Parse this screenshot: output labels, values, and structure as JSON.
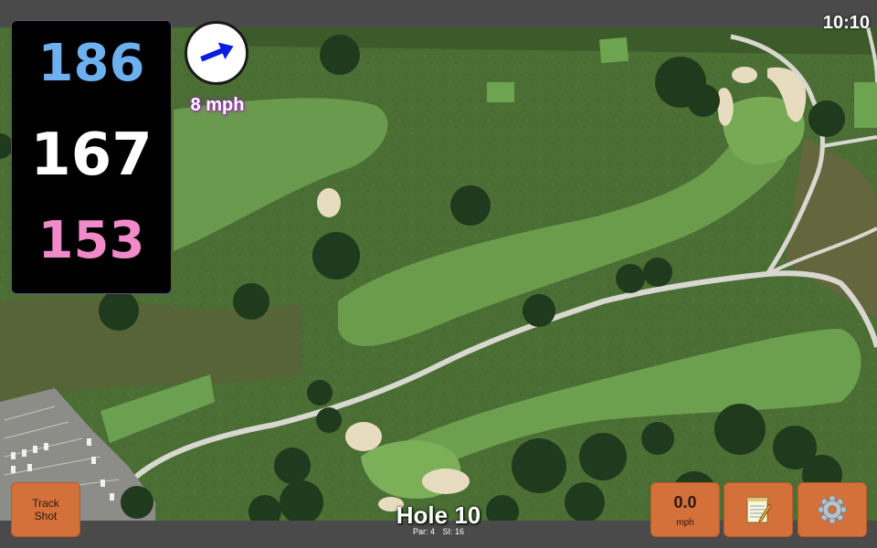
{
  "status": {
    "time": "10:10"
  },
  "distances": {
    "back": "186",
    "middle": "167",
    "front": "153"
  },
  "wind": {
    "speed": "8 mph",
    "direction_icon": "wind-arrow-icon"
  },
  "hole": {
    "title": "Hole 10",
    "par": "Par: 4",
    "stroke_index": "SI: 16"
  },
  "buttons": {
    "track_shot_line1": "Track",
    "track_shot_line2": "Shot",
    "wind_value": "0.0",
    "wind_unit": "mph",
    "notes_icon": "notepad-icon",
    "settings_icon": "gear-icon"
  },
  "colors": {
    "back_distance": "#6cb0f0",
    "middle_distance": "#ffffff",
    "front_distance": "#f08ac8",
    "button_bg": "#d4703a",
    "wind_arrow": "#0a1ee0"
  }
}
